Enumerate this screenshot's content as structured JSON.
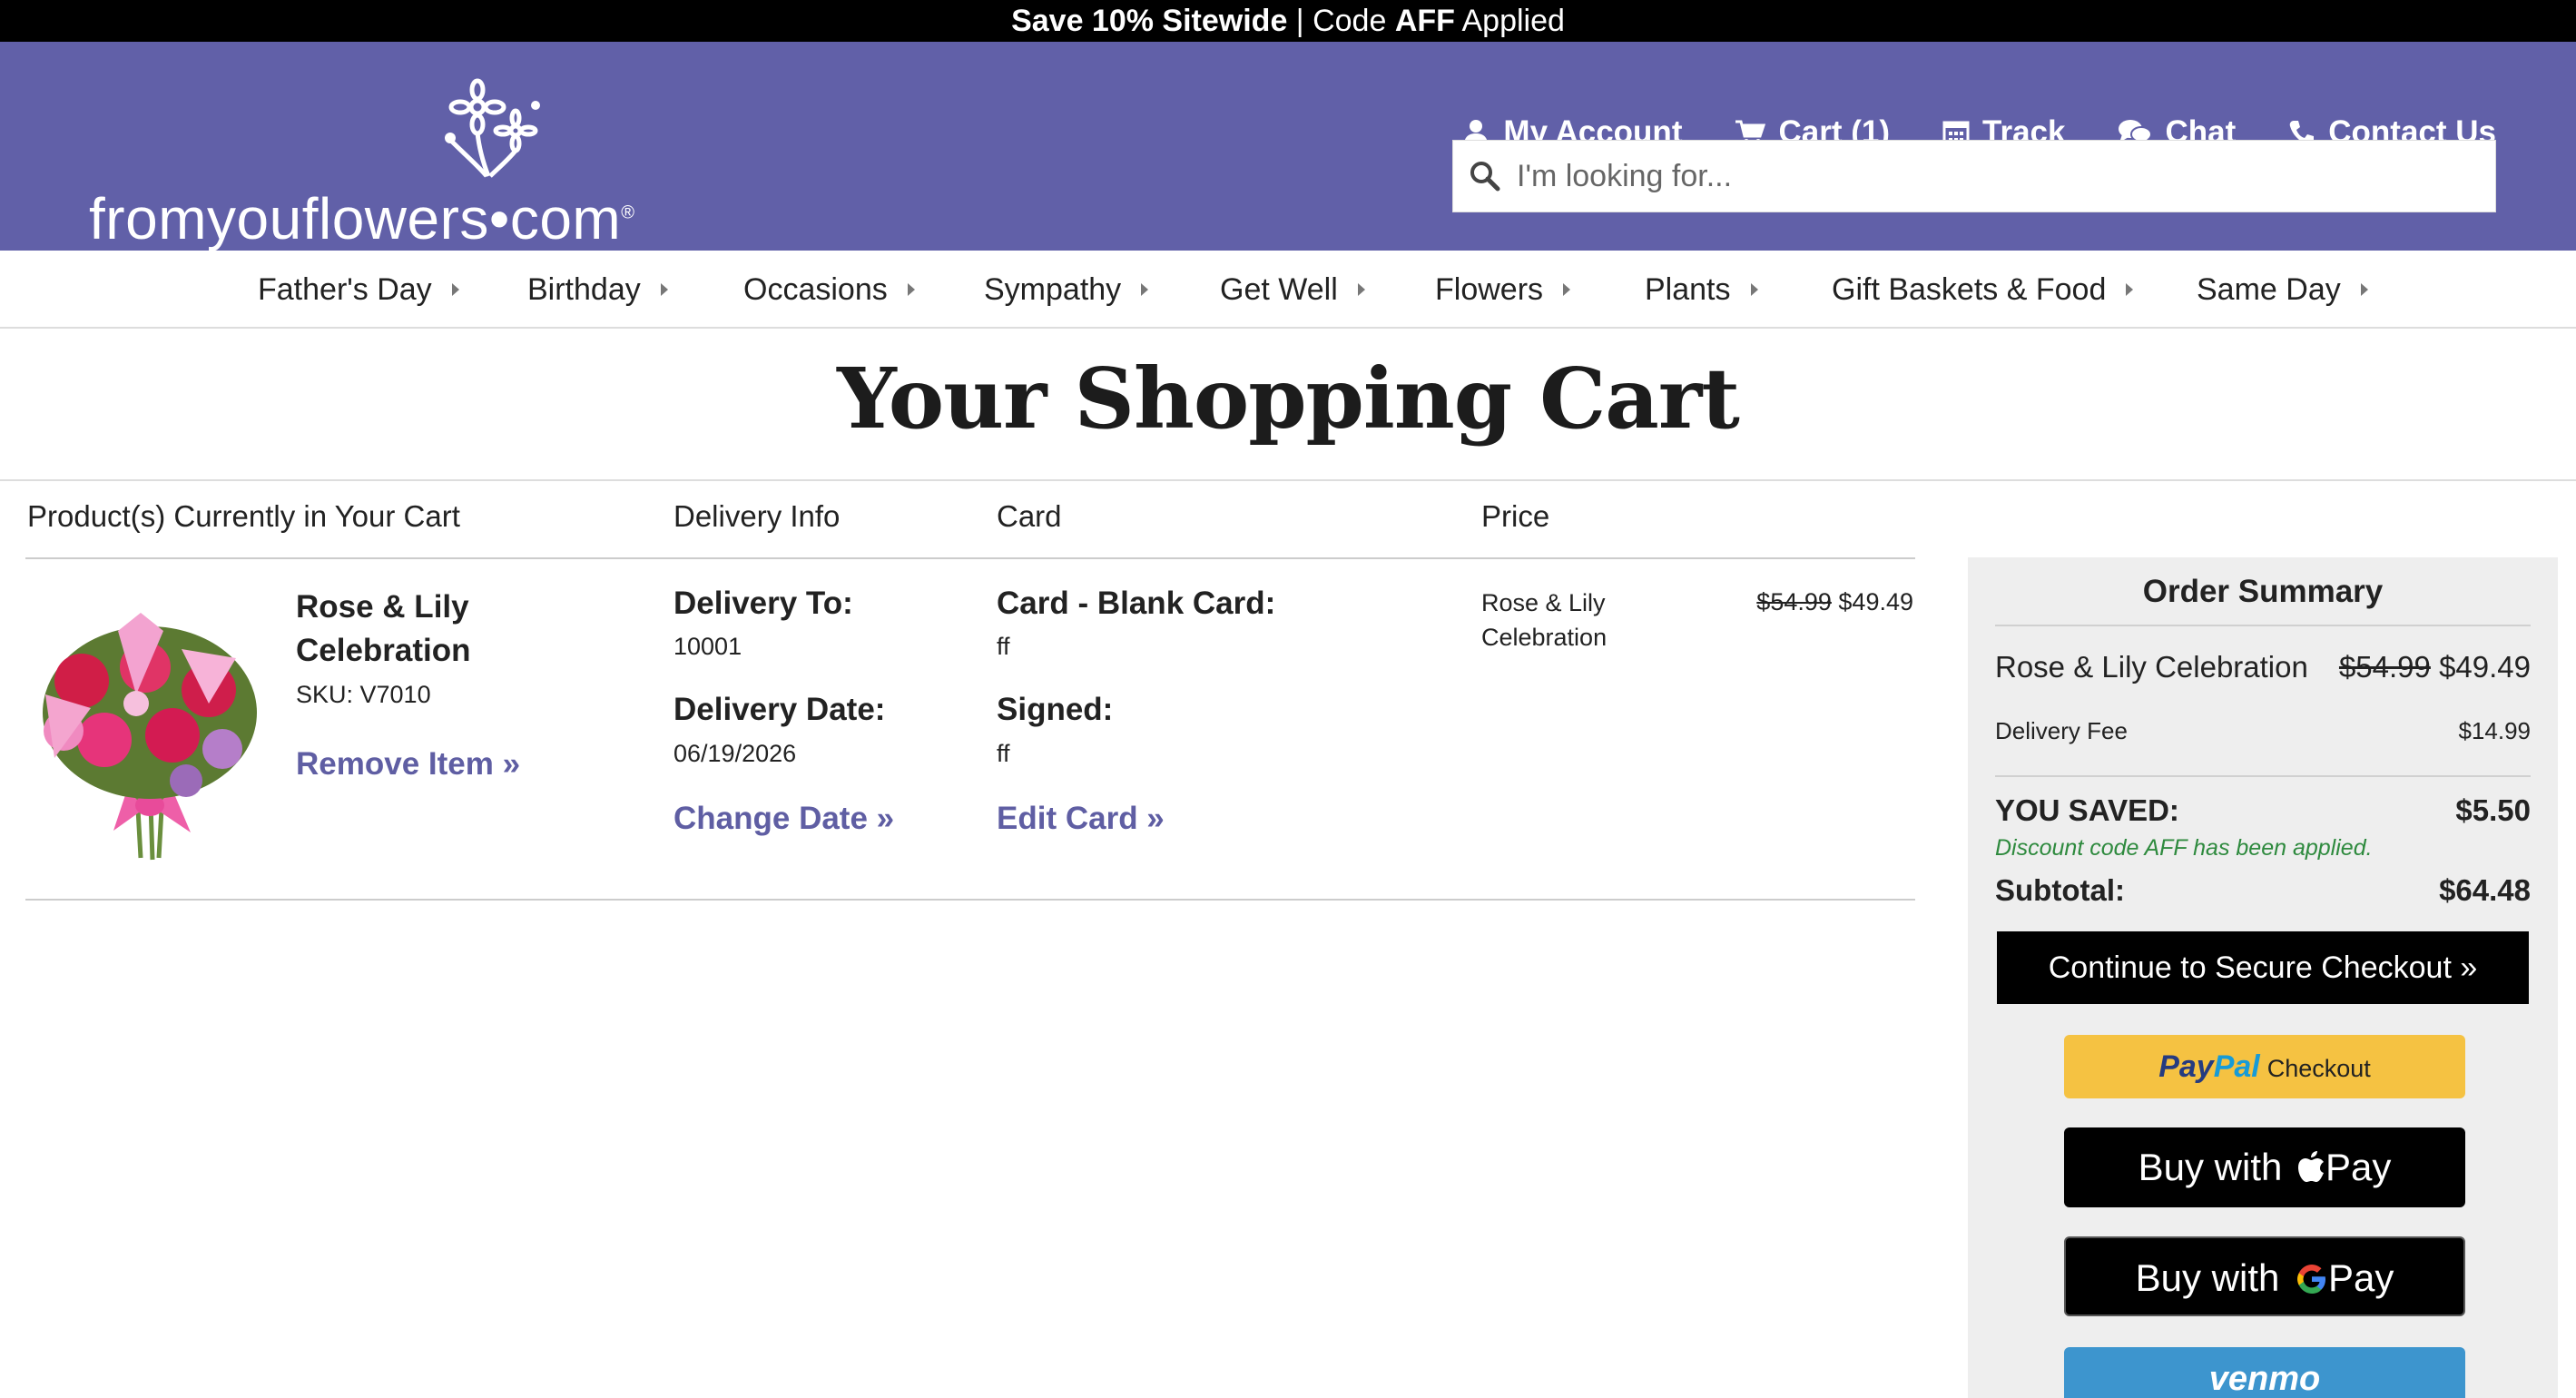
{
  "promo": {
    "bold": "Save 10% Sitewide",
    "sep": " | Code ",
    "code": "AFF",
    "tail": " Applied"
  },
  "brand": {
    "logo_text": "fromyouflowers",
    "logo_dot": "•",
    "logo_tld": "com",
    "reg": "®"
  },
  "topnav": {
    "account": "My Account",
    "cart": "Cart (1)",
    "track": "Track",
    "chat": "Chat",
    "contact": "Contact Us"
  },
  "search": {
    "placeholder": "I'm looking for..."
  },
  "categories": [
    "Father's Day",
    "Birthday",
    "Occasions",
    "Sympathy",
    "Get Well",
    "Flowers",
    "Plants",
    "Gift Baskets & Food",
    "Same Day"
  ],
  "page_title": "Your Shopping Cart",
  "columns": {
    "products": "Product(s) Currently in Your Cart",
    "delivery": "Delivery Info",
    "card": "Card",
    "price": "Price"
  },
  "item": {
    "name": "Rose & Lily Celebration",
    "sku": "SKU: V7010",
    "remove": "Remove Item »",
    "delivery_to_label": "Delivery To:",
    "delivery_to": "10001",
    "delivery_date_label": "Delivery Date:",
    "delivery_date": "06/19/2026",
    "change_date": "Change Date »",
    "card_label": "Card - Blank Card:",
    "card_value": "ff",
    "signed_label": "Signed:",
    "signed_value": "ff",
    "edit_card": "Edit Card »",
    "price_name": "Rose & Lily Celebration",
    "old_price": "$54.99",
    "price": "$49.49"
  },
  "summary": {
    "title": "Order Summary",
    "product": "Rose & Lily Celebration",
    "product_old": "$54.99",
    "product_price": "$49.49",
    "delivery_fee_label": "Delivery Fee",
    "delivery_fee": "$14.99",
    "saved_label": "YOU SAVED:",
    "saved": "$5.50",
    "discount_note": "Discount code AFF has been applied.",
    "subtotal_label": "Subtotal:",
    "subtotal": "$64.48",
    "checkout": "Continue to Secure Checkout »",
    "paypal_a": "Pay",
    "paypal_b": "Pal",
    "paypal_c": "Checkout",
    "apple": "Buy with",
    "apple_pay": "Pay",
    "google": "Buy with",
    "google_pay": "Pay",
    "venmo": "venmo"
  },
  "colors": {
    "header": "#6160a8",
    "link": "#5f5ea3",
    "saved": "#2e8a3e"
  }
}
